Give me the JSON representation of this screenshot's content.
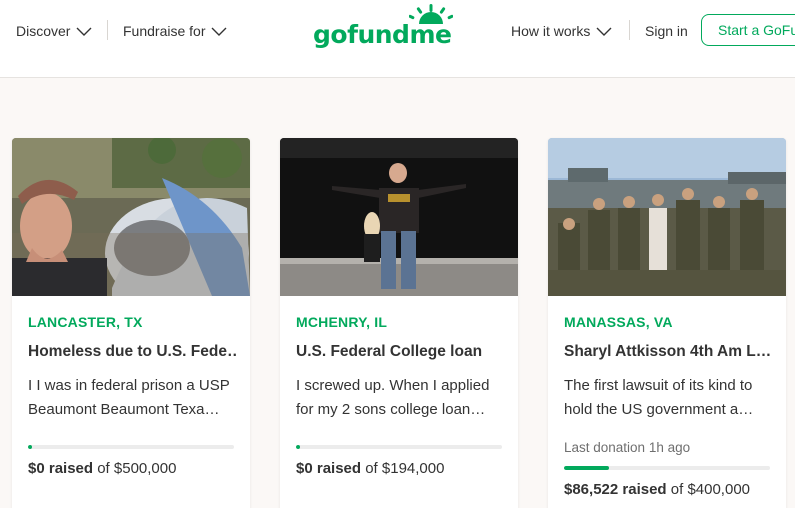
{
  "header": {
    "nav_left": [
      {
        "label": "Discover"
      },
      {
        "label": "Fundraise for"
      }
    ],
    "logo_text": "gofundme",
    "nav_right": [
      {
        "label": "How it works"
      },
      {
        "label": "Sign in"
      }
    ],
    "start_button": "Start a GoFu"
  },
  "colors": {
    "brand_green": "#02a95c",
    "text": "#333333",
    "background": "#fbf8f6"
  },
  "cards": [
    {
      "location": "LANCASTER, TX",
      "title": "Homeless due to U.S. Fede…",
      "desc_line1": "I I was in federal prison a USP",
      "desc_line2": "Beaumont Beaumont Texa…",
      "last_donation": "",
      "progress": 0.02,
      "raised_amount": "$0 raised",
      "goal_text": " of $500,000"
    },
    {
      "location": "MCHENRY, IL",
      "title": "U.S. Federal College loan",
      "desc_line1": "I screwed up. When I applied",
      "desc_line2": "for my 2 sons college loan…",
      "last_donation": "",
      "progress": 0.02,
      "raised_amount": "$0 raised",
      "goal_text": " of $194,000"
    },
    {
      "location": "MANASSAS, VA",
      "title": "Sharyl Attkisson 4th Am L…",
      "desc_line1": "The first lawsuit of its kind to",
      "desc_line2": "hold the US government a…",
      "last_donation": "Last donation 1h ago",
      "progress": 0.22,
      "raised_amount": "$86,522 raised",
      "goal_text": " of $400,000"
    }
  ]
}
